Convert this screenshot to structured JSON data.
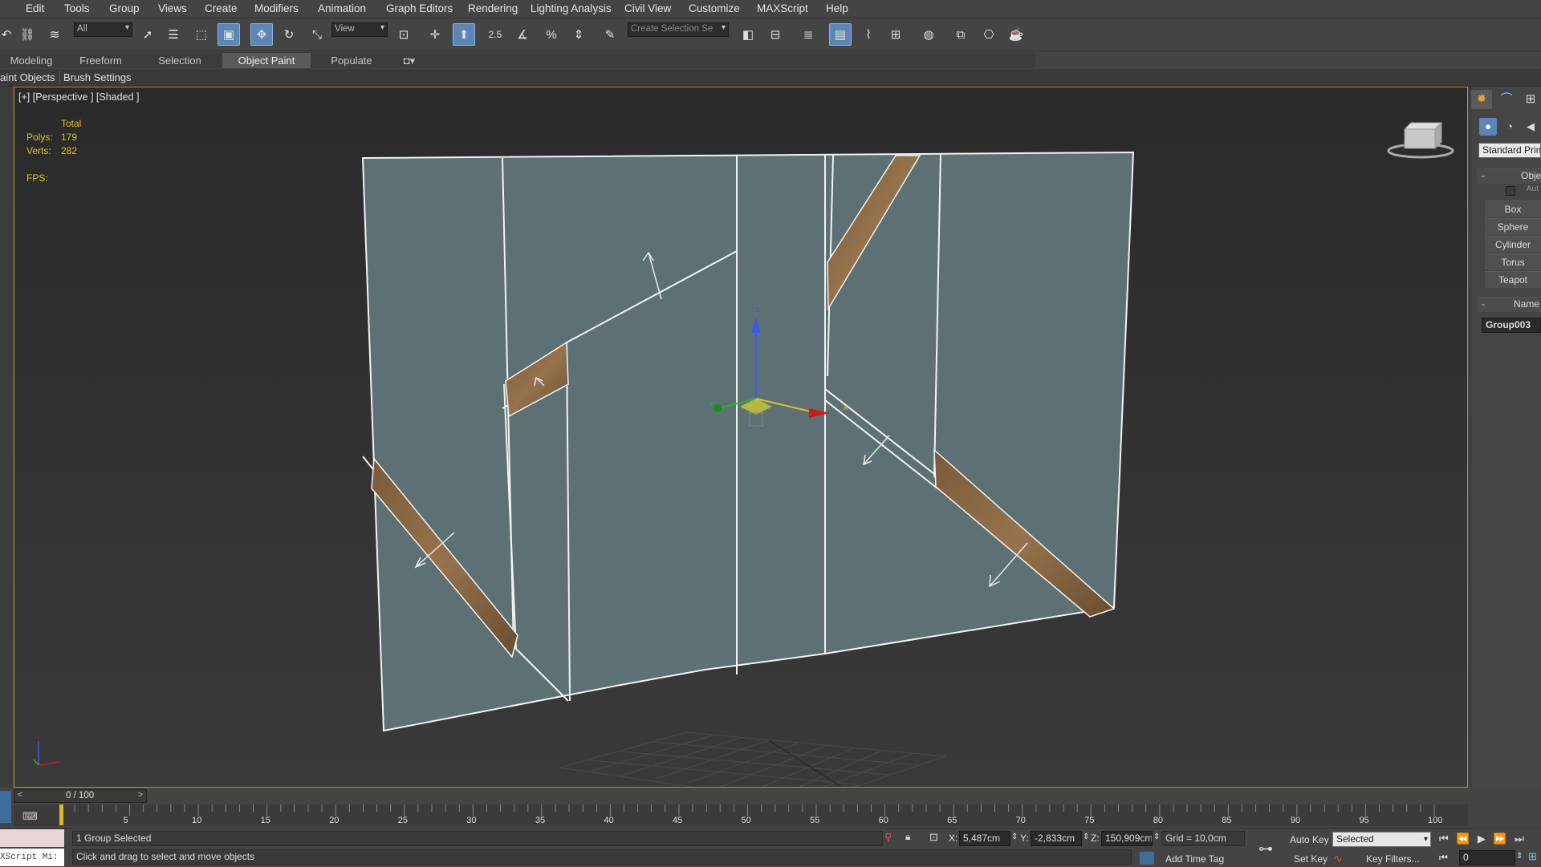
{
  "menu": [
    "Edit",
    "Tools",
    "Group",
    "Views",
    "Create",
    "Modifiers",
    "Animation",
    "Graph Editors",
    "Rendering",
    "Lighting Analysis",
    "Civil View",
    "Customize",
    "MAXScript",
    "Help"
  ],
  "toolbar": {
    "selection_filter": "All",
    "reference_coord": "View",
    "snap_label": "2.5",
    "named_selection_placeholder": "Create Selection Se"
  },
  "ribbon": {
    "tabs": [
      "Modeling",
      "Freeform",
      "Selection",
      "Object Paint",
      "Populate"
    ],
    "active_tab": "Object Paint",
    "subtabs": [
      "aint Objects",
      "Brush Settings"
    ]
  },
  "viewport": {
    "label": "[+] [Perspective ] [Shaded ]",
    "stats": {
      "header": "Total",
      "polys_label": "Polys:",
      "polys": "179",
      "verts_label": "Verts:",
      "verts": "282",
      "fps_label": "FPS:"
    },
    "gizmo": {
      "x": "x",
      "y": "y",
      "z": "z"
    }
  },
  "command_panel": {
    "category": "Standard Primi",
    "rollout_object_type": "Obje",
    "autogrid": "Aut",
    "buttons": [
      "Box",
      "Sphere",
      "Cylinder",
      "Torus",
      "Teapot"
    ],
    "rollout_name": "Name",
    "object_name": "Group003"
  },
  "timeline": {
    "frame_display": "0 / 100",
    "ticks": [
      5,
      10,
      15,
      20,
      25,
      30,
      35,
      40,
      45,
      50,
      55,
      60,
      65,
      70,
      75,
      80,
      85,
      90,
      95,
      100
    ]
  },
  "status": {
    "selection": "1 Group Selected",
    "prompt": "Click and drag to select and move objects",
    "maxscript": "XScript Mi:",
    "x_label": "X:",
    "x": "5,487cm",
    "y_label": "Y:",
    "y": "-2,833cm",
    "z_label": "Z:",
    "z": "150,909cm",
    "grid": "Grid = 10,0cm",
    "add_time_tag": "Add Time Tag",
    "auto_key": "Auto Key",
    "set_key": "Set Key",
    "key_mode": "Selected",
    "key_filters": "Key Filters...",
    "current_frame": "0"
  },
  "colors": {
    "accent": "#5b86b5",
    "viewport_border": "#b8922b",
    "stats": "#e0c419"
  }
}
